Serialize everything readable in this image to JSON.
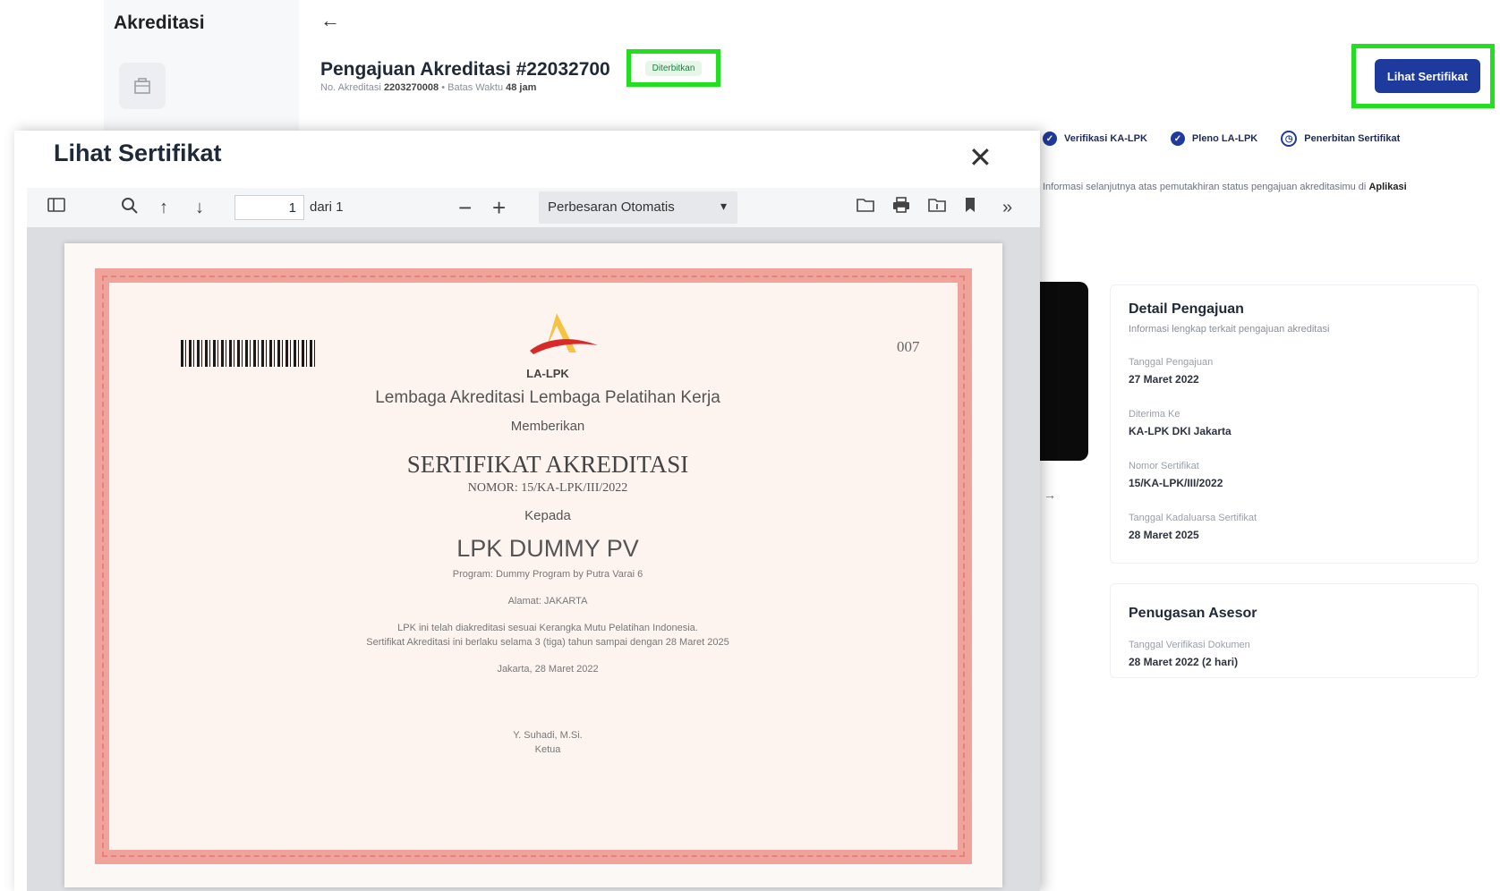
{
  "sidebar": {
    "title": "Akreditasi",
    "icon": "building-icon"
  },
  "header": {
    "back_icon": "arrow-left-icon",
    "title": "Pengajuan Akreditasi #22032700",
    "status": "Diterbitkan",
    "subtitle_label": "No. Akreditasi",
    "subtitle_value": "2203270008",
    "subtitle_sep": "•",
    "subtitle_label2": "Batas Waktu",
    "subtitle_value2": "48 jam",
    "view_cert_button": "Lihat Sertifikat"
  },
  "steps": [
    {
      "label": "Verifikasi KA-LPK",
      "state": "done"
    },
    {
      "label": "Pleno LA-LPK",
      "state": "done"
    },
    {
      "label": "Penerbitan Sertifikat",
      "state": "current"
    }
  ],
  "info_line": {
    "text": "Informasi selanjutnya atas pemutakhiran status pengajuan akreditasimu di",
    "link": "Aplikasi"
  },
  "detail": {
    "title": "Detail Pengajuan",
    "subtitle": "Informasi lengkap terkait pengajuan akreditasi",
    "fields": [
      {
        "label": "Tanggal Pengajuan",
        "value": "27 Maret 2022"
      },
      {
        "label": "Diterima Ke",
        "value": "KA-LPK DKI Jakarta"
      },
      {
        "label": "Nomor Sertifikat",
        "value": "15/KA-LPK/III/2022"
      },
      {
        "label": "Tanggal Kadaluarsa Sertifikat",
        "value": "28 Maret 2025"
      }
    ]
  },
  "asesor": {
    "title": "Penugasan Asesor",
    "field_label": "Tanggal Verifikasi Dokumen",
    "field_value": "28 Maret 2022 (2 hari)"
  },
  "modal": {
    "title": "Lihat Sertifikat",
    "close_icon": "close-icon",
    "toolbar": {
      "sidebar_icon": "sidebar-toggle-icon",
      "search_icon": "search-icon",
      "prev_icon": "arrow-up-icon",
      "next_icon": "arrow-down-icon",
      "page_value": "1",
      "of_label": "dari 1",
      "zoom_out_icon": "minus-icon",
      "zoom_in_icon": "plus-icon",
      "zoom_label": "Perbesaran Otomatis",
      "open_icon": "open-file-icon",
      "print_icon": "print-icon",
      "save_icon": "folder-icon",
      "bookmark_icon": "bookmark-icon",
      "more_icon": "double-chevron-right-icon"
    }
  },
  "certificate": {
    "number_top": "007",
    "logo_text": "LA-LPK",
    "org": "Lembaga Akreditasi Lembaga Pelatihan Kerja",
    "gives": "Memberikan",
    "heading": "SERTIFIKAT AKREDITASI",
    "nomor": "NOMOR: 15/KA-LPK/III/2022",
    "kepada": "Kepada",
    "recipient": "LPK DUMMY PV",
    "program": "Program: Dummy Program by Putra Varai 6",
    "alamat": "Alamat: JAKARTA",
    "body1": "LPK ini telah diakreditasi sesuai Kerangka Mutu Pelatihan Indonesia.",
    "body2": "Sertifikat Akreditasi ini berlaku selama 3 (tiga) tahun sampai dengan 28 Maret 2025",
    "place_date": "Jakarta, 28 Maret 2022",
    "signer": "Y. Suhadi, M.Si.",
    "signer_role": "Ketua"
  },
  "colors": {
    "highlight": "#22e01f",
    "primary": "#1e3a9c",
    "cert_border": "#f0a39b"
  }
}
